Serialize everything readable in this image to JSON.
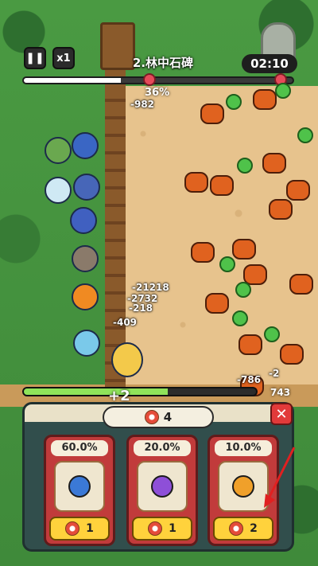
{
  "hud": {
    "pause_icon": "pause-icon",
    "speed_label": "x1",
    "level_title": "2.林中石碑",
    "timer": "02:10",
    "progress_percent": "36%",
    "progress_fraction": 0.36
  },
  "damage_numbers": [
    "-982",
    "-21218",
    "-2732",
    "-218",
    "-409",
    "-786",
    "-2"
  ],
  "bottom": {
    "wave_bonus": "+2",
    "kill_count": "743",
    "xp_fraction": 0.62,
    "token_count": "4",
    "close_icon": "close-icon",
    "cards": [
      {
        "chance": "60.0%",
        "cost": "1",
        "gem_color": "#3b79d6"
      },
      {
        "chance": "20.0%",
        "cost": "1",
        "gem_color": "#8e4fd8"
      },
      {
        "chance": "10.0%",
        "cost": "2",
        "gem_color": "#f0a02a"
      }
    ]
  },
  "colors": {
    "arrow": "#e02020"
  }
}
